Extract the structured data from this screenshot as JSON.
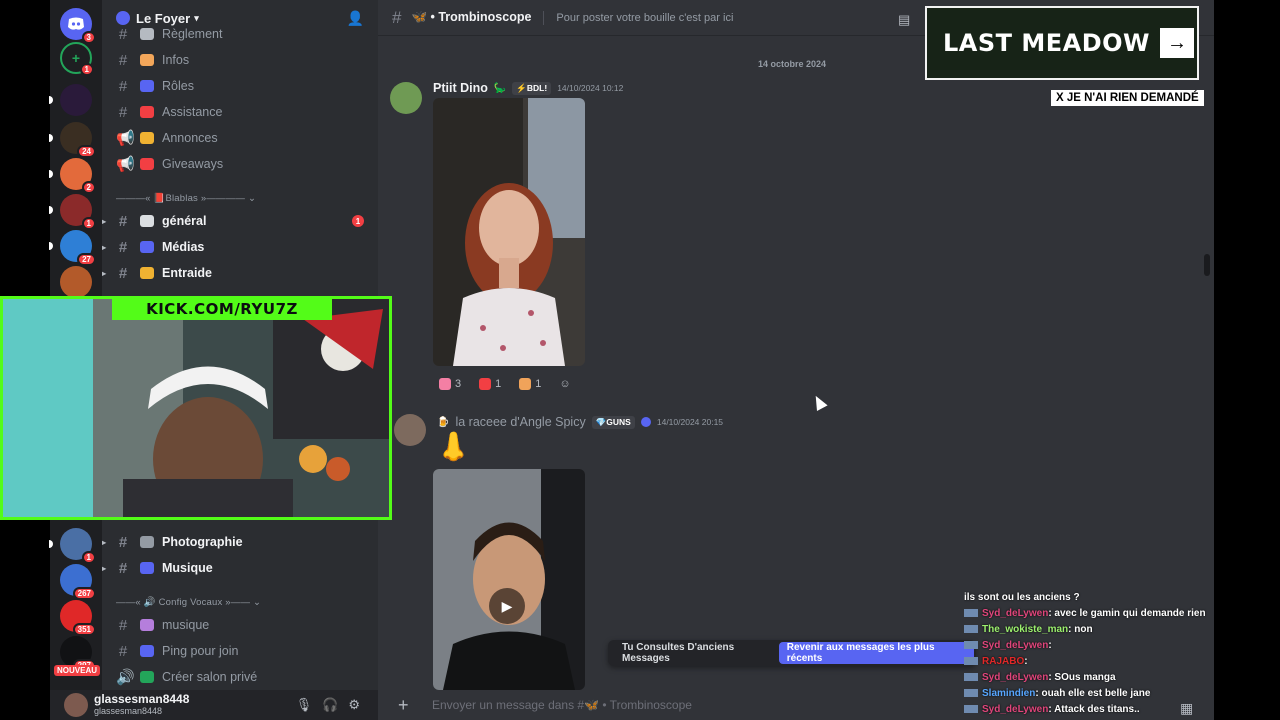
{
  "guild": {
    "name": "Le Foyer"
  },
  "channels": [
    {
      "name": "Règlement",
      "icon": "pencil",
      "color": "#b5bac1"
    },
    {
      "name": "Infos",
      "icon": "info",
      "color": "#f2a65a"
    },
    {
      "name": "Rôles",
      "icon": "roles",
      "color": "#5865f2"
    },
    {
      "name": "Assistance",
      "icon": "sos",
      "color": "#f23f43"
    },
    {
      "name": "Annonces",
      "icon": "bell",
      "color": "#f0b232",
      "type": "announce"
    },
    {
      "name": "Giveaways",
      "icon": "gift",
      "color": "#f23f43",
      "type": "announce"
    }
  ],
  "category_blablas": "———« 📕Blablas »———— ⌄",
  "channels_blablas": [
    {
      "name": "général",
      "color": "#dbdee1",
      "unread": "1"
    },
    {
      "name": "Médias",
      "color": "#5865f2"
    },
    {
      "name": "Entraide",
      "color": "#f0b232"
    }
  ],
  "channels_lower": [
    {
      "name": "Photographie",
      "color": "#949ba4"
    },
    {
      "name": "Musique",
      "color": "#5865f2"
    }
  ],
  "category_vocaux": "——« 🔊 Config Vocaux »—— ⌄",
  "channels_voice": [
    {
      "name": "musique",
      "color": "#b57edc"
    },
    {
      "name": "Ping pour join",
      "color": "#5865f2"
    },
    {
      "name": "Créer salon privé",
      "color": "#23a55a"
    }
  ],
  "servers": [
    {
      "badge": "3",
      "color": "#5865f2",
      "icon": "discord-icon"
    },
    {
      "badge": "1",
      "color": "#23a55a",
      "icon": "add-server-icon"
    },
    {
      "badge": "",
      "color": "#2a1a3a"
    },
    {
      "badge": "24",
      "color": "#3a2e22"
    },
    {
      "badge": "2",
      "color": "#e36a3b"
    },
    {
      "badge": "1",
      "color": "#8b2a2a"
    },
    {
      "badge": "27",
      "color": "#2e7fd6"
    },
    {
      "badge": "",
      "color": "#b35a2a"
    },
    {
      "badge": "1",
      "color": "#4a6fa5"
    },
    {
      "badge": "267",
      "color": "#3c6fd1"
    },
    {
      "badge": "351",
      "color": "#e02828"
    },
    {
      "badge": "297",
      "color": "#111214"
    }
  ],
  "nouveau_label": "NOUVEAU",
  "user": {
    "display": "glassesman8448",
    "username": "glassesman8448"
  },
  "header": {
    "channel": "🦋 • Trombinoscope",
    "topic": "Pour poster votre bouille c'est par ici"
  },
  "date_divider": "14 octobre 2024",
  "messages": [
    {
      "author": "Ptiit Dino",
      "tag": "⚡BDL!",
      "time": "14/10/2024 10:12",
      "author_color": "#f2f3f5"
    },
    {
      "author": "la raceee d'Angle Spicy",
      "tag": "💎GUNS",
      "time": "14/10/2024 20:15",
      "author_color": "#949ba4"
    }
  ],
  "reactions": [
    {
      "count": "3",
      "color": "#f47fa4"
    },
    {
      "count": "1",
      "color": "#f23f43"
    },
    {
      "count": "1",
      "color": "#f0a35a"
    }
  ],
  "old_messages": {
    "text": "Tu Consultes D'anciens Messages",
    "jump": "Revenir aux messages les plus récents"
  },
  "composer": {
    "placeholder": "Envoyer un message dans #🦋 • Trombinoscope"
  },
  "ad": {
    "text": "LAST MEADOW",
    "close": "X JE N'AI RIEN DEMANDÉ"
  },
  "stream": {
    "kick": "KICK.COM/RYU7Z"
  },
  "stream_chat": [
    {
      "user": "",
      "text": "ils sont ou les anciens ?",
      "color": "#ffffff"
    },
    {
      "user": "Syd_deLywen",
      "text": ": avec le gamin qui demande rien",
      "color": "#e0457b"
    },
    {
      "user": "The_wokiste_man",
      "text": ": non",
      "color": "#9cf06e"
    },
    {
      "user": "Syd_deLywen",
      "text": ":",
      "color": "#e0457b"
    },
    {
      "user": "RAJABO",
      "text": ":",
      "color": "#e02828"
    },
    {
      "user": "Syd_deLywen",
      "text": ": SOus manga",
      "color": "#e0457b"
    },
    {
      "user": "Slamindien",
      "text": ": ouah elle est belle jane",
      "color": "#57a6ff"
    },
    {
      "user": "Syd_deLywen",
      "text": ": Attack des titans..",
      "color": "#e0457b"
    }
  ]
}
